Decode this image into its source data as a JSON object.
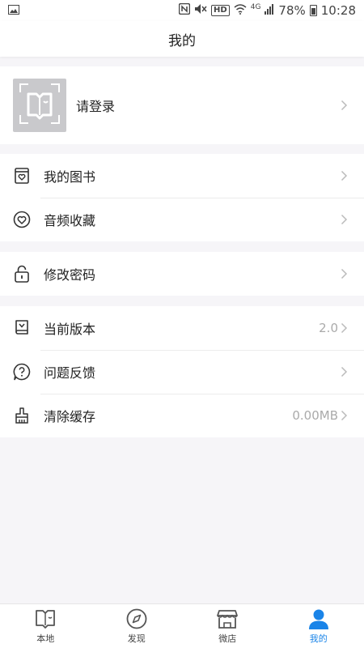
{
  "status_bar": {
    "hd_label": "HD",
    "network": "4G",
    "battery": "78%",
    "time": "10:28",
    "icons": [
      "image-icon",
      "nfc-icon",
      "mute-icon",
      "wifi-icon",
      "signal-icon",
      "battery-icon"
    ]
  },
  "header": {
    "title": "我的"
  },
  "login": {
    "label": "请登录",
    "avatar_icon": "book-face-icon"
  },
  "menu_group_1": [
    {
      "label": "我的图书",
      "icon": "book-heart-icon"
    },
    {
      "label": "音频收藏",
      "icon": "heart-circle-icon"
    }
  ],
  "menu_group_2": [
    {
      "label": "修改密码",
      "icon": "lock-icon"
    }
  ],
  "menu_group_3": [
    {
      "label": "当前版本",
      "value": "2.0",
      "icon": "version-icon"
    },
    {
      "label": "问题反馈",
      "icon": "question-icon"
    },
    {
      "label": "清除缓存",
      "value": "0.00MB",
      "icon": "broom-icon"
    }
  ],
  "tabs": [
    {
      "label": "本地",
      "icon": "local-book-icon",
      "active": false
    },
    {
      "label": "发现",
      "icon": "compass-icon",
      "active": false
    },
    {
      "label": "微店",
      "icon": "shop-icon",
      "active": false
    },
    {
      "label": "我的",
      "icon": "person-icon",
      "active": true
    }
  ],
  "colors": {
    "accent": "#1a84e8",
    "background": "#f6f5f8",
    "chevron": "#bbbbbb",
    "value_text": "#aaaaaa"
  }
}
